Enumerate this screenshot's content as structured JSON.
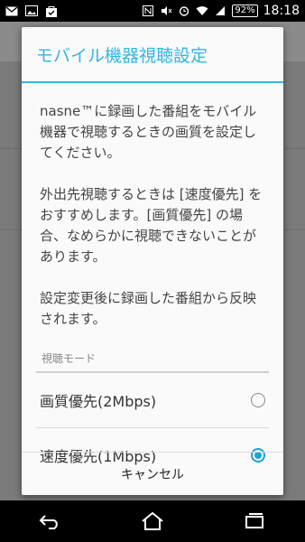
{
  "status_bar": {
    "battery": "92%",
    "time": "18:18",
    "icons": [
      "gmail-icon",
      "image-icon",
      "shopping-bag-icon",
      "nfc-icon",
      "mute-icon",
      "alarm-icon",
      "wifi-icon",
      "signal-icon"
    ]
  },
  "dialog": {
    "title": "モバイル機器視聴設定",
    "paragraphs": [
      "nasne™に録画した番組をモバイル機器で視聴するときの画質を設定してください。",
      "外出先視聴するときは [速度優先] をおすすめします。[画質優先] の場合、なめらかに視聴できないことがあります。",
      "設定変更後に録画した番組から反映されます。"
    ],
    "section_header": "視聴モード",
    "options": [
      {
        "label": "画質優先(2Mbps)",
        "checked": false
      },
      {
        "label": "速度優先(1Mbps)",
        "checked": true
      }
    ],
    "cancel_label": "キャンセル"
  },
  "nav": {
    "icons": [
      "back-icon",
      "home-icon",
      "recent-apps-icon"
    ]
  },
  "colors": {
    "accent": "#33b5e5",
    "radio_checked": "#1aa2d9"
  }
}
